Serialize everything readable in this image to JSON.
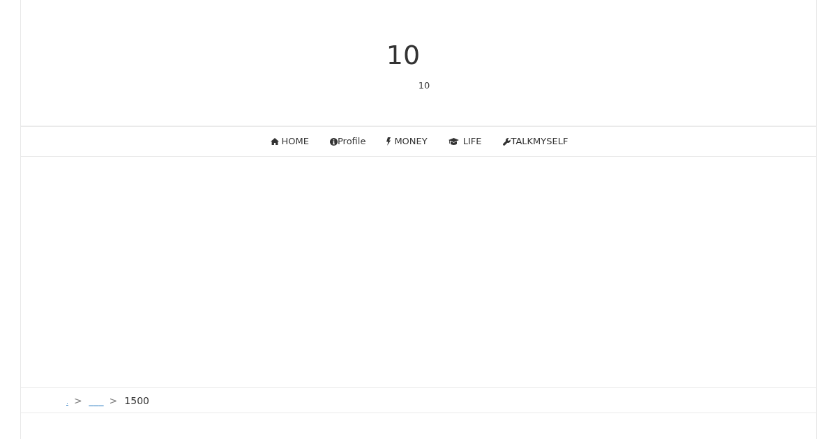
{
  "header": {
    "title": "10",
    "subtitle": "10"
  },
  "nav": {
    "items": [
      {
        "label": "HOME"
      },
      {
        "label": "Profile"
      },
      {
        "label": "MONEY"
      },
      {
        "label": "LIFE"
      },
      {
        "label": "TALKMYSELF"
      }
    ]
  },
  "breadcrumb": {
    "items": [
      {
        "kind": "link",
        "label": "."
      },
      {
        "kind": "separator",
        "label": ">"
      },
      {
        "kind": "link",
        "label": "___"
      },
      {
        "kind": "separator",
        "label": ">"
      },
      {
        "kind": "current",
        "label": "1500"
      }
    ]
  }
}
